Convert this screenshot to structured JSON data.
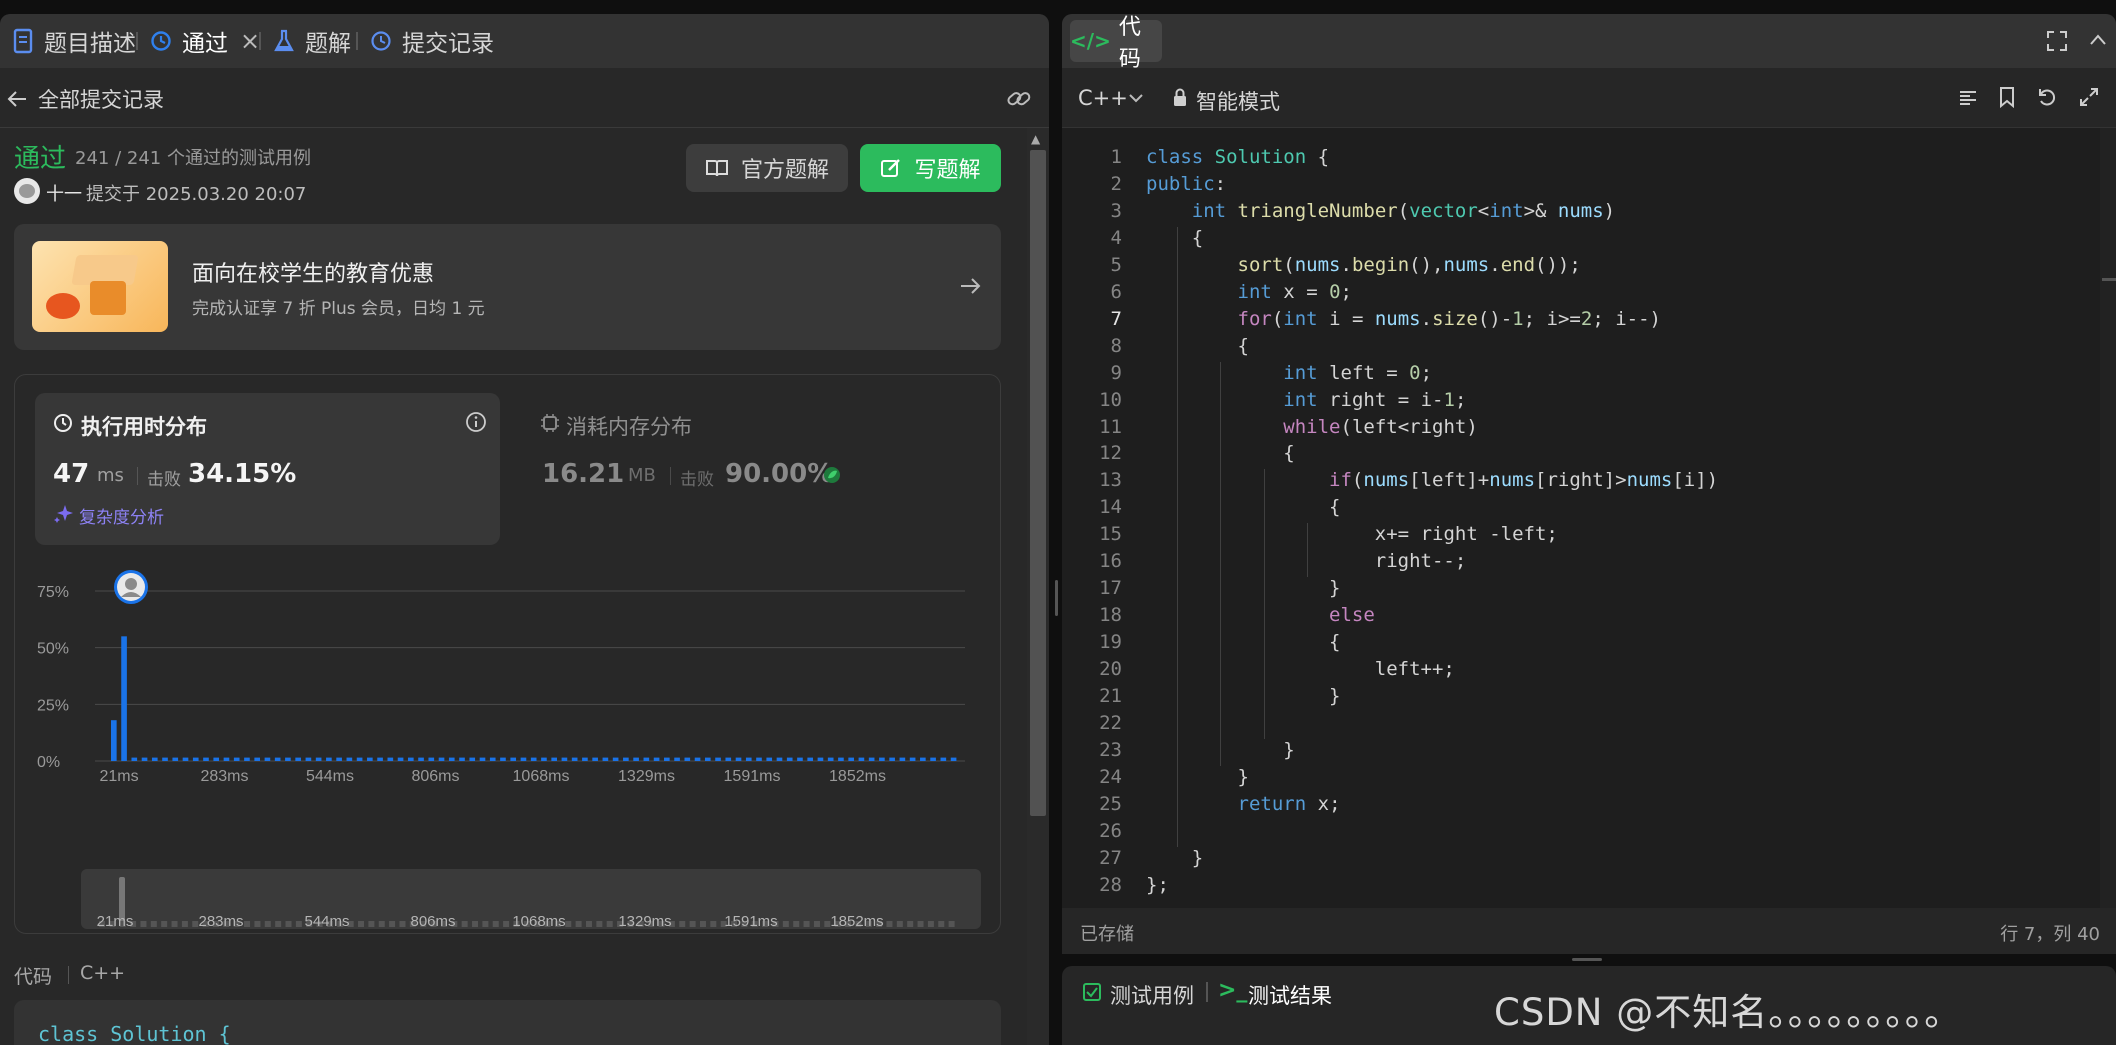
{
  "left_tabs": {
    "description": "题目描述",
    "accepted": "通过",
    "solutions": "题解",
    "submissions": "提交记录"
  },
  "subbar": {
    "back_label": "全部提交记录"
  },
  "result": {
    "status": "通过",
    "cases": "241 / 241 个通过的测试用例",
    "user": "十一",
    "submitted": "提交于 2025.03.20 20:07",
    "official_button": "官方题解",
    "write_button": "写题解"
  },
  "promo": {
    "title": "面向在校学生的教育优惠",
    "subtitle": "完成认证享 7 折 Plus 会员，日均 1 元"
  },
  "runtime": {
    "title": "执行用时分布",
    "value": "47",
    "unit": "ms",
    "beats_label": "击败",
    "beats": "34.15%",
    "complexity": "复杂度分析"
  },
  "memory": {
    "title": "消耗内存分布",
    "value": "16.21",
    "unit": "MB",
    "beats_label": "击败",
    "beats": "90.00%"
  },
  "chart_data": {
    "type": "bar",
    "title": "",
    "xlabel": "",
    "ylabel": "",
    "y_ticks": [
      "75%",
      "50%",
      "25%",
      "0%"
    ],
    "ylim": [
      0,
      75
    ],
    "x_ticks": [
      "21ms",
      "283ms",
      "544ms",
      "806ms",
      "1068ms",
      "1329ms",
      "1591ms",
      "1852ms"
    ],
    "grid": true,
    "highlight_bar_index": 1,
    "values": [
      18,
      55,
      1.5,
      1.5,
      1.5,
      1.5,
      1.5,
      1.5,
      1.5,
      1.5,
      1.5,
      1.5,
      1.5,
      1.5,
      1.5,
      1.5,
      1.5,
      1.5,
      1.5,
      1.5,
      1.5,
      1.5,
      1.5,
      1.5,
      1.5,
      1.5,
      1.5,
      1.5,
      1.5,
      1.5,
      1.5,
      1.5,
      1.5,
      1.5,
      1.5,
      1.5,
      1.5,
      1.5,
      1.5,
      1.5,
      1.5,
      1.5,
      1.5,
      1.5,
      1.5,
      1.5,
      1.5,
      1.5,
      1.5,
      1.5,
      1.5,
      1.5,
      1.5,
      1.5,
      1.5,
      1.5,
      1.5,
      1.5,
      1.5,
      1.5,
      1.5,
      1.5,
      1.5,
      1.5,
      1.5,
      1.5,
      1.5,
      1.5,
      1.5,
      1.5,
      1.5,
      1.5,
      1.5,
      1.5,
      1.5,
      1.5,
      1.5,
      1.5,
      1.5,
      1.5,
      1.5,
      1.5,
      1.5
    ],
    "bar_color": "#1a73e8"
  },
  "lower_code": {
    "label": "代码",
    "lang": "C++",
    "first_line": "class Solution {"
  },
  "right_tabs": {
    "code": "代码"
  },
  "code_toolbar": {
    "language": "C++",
    "mode": "智能模式"
  },
  "code_lines": [
    "class Solution {",
    "public:",
    "    int triangleNumber(vector<int>& nums)",
    "    {",
    "        sort(nums.begin(),nums.end());",
    "        int x = 0;",
    "        for(int i = nums.size()-1; i>=2; i--)",
    "        {",
    "            int left = 0;",
    "            int right = i-1;",
    "            while(left<right)",
    "            {",
    "                if(nums[left]+nums[right]>nums[i])",
    "                {",
    "                    x+= right -left;",
    "                    right--;",
    "                }",
    "                else",
    "                {",
    "                    left++;",
    "                }",
    "",
    "            }",
    "        }",
    "        return x;",
    "",
    "    }",
    "};"
  ],
  "status": {
    "saved": "已存储",
    "cursor": "行 7，列 40"
  },
  "bottom_tabs": {
    "testcase": "测试用例",
    "result": "测试结果"
  },
  "watermark": "CSDN @不知名。。。。。。。。。",
  "colors": {
    "accent_green": "#2cbb5d",
    "bar_blue": "#1a73e8",
    "tab_blue": "#2f80ed"
  }
}
